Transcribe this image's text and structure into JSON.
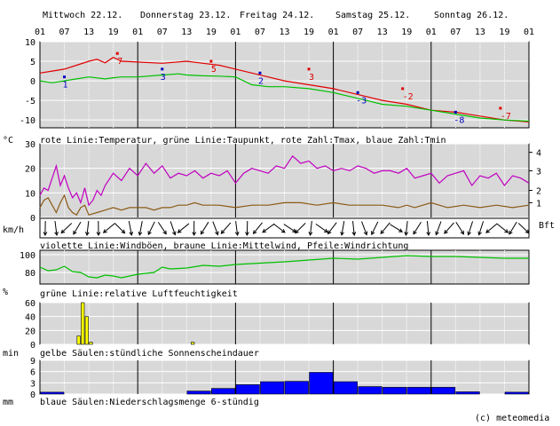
{
  "header": {
    "days": [
      "Mittwoch 22.12.",
      "Donnerstag 23.12.",
      "Freitag 24.12.",
      "Samstag 25.12.",
      "Sonntag 26.12."
    ],
    "hour_ticks": [
      "01",
      "07",
      "13",
      "19",
      "01",
      "07",
      "13",
      "19",
      "01",
      "07",
      "13",
      "19",
      "01",
      "07",
      "13",
      "19",
      "01",
      "07",
      "13",
      "19",
      "01"
    ]
  },
  "copyright": "(c) meteomedia",
  "colors": {
    "panel_bg": "#d8d8d8",
    "temperature": "#e00000",
    "dewpoint": "#00c000",
    "tmin": "#0000c0",
    "gust": "#c000c0",
    "mean_wind": "#8b5a16",
    "humidity": "#00c000",
    "sun_bar": "#ffff00",
    "precip_bar": "#0000ff"
  },
  "chart_data": [
    {
      "type": "line",
      "panel": "temperature",
      "unit_label": "°C",
      "caption": "rote Linie:Temperatur, grüne Linie:Taupunkt, rote Zahl:Tmax, blaue Zahl:Tmin",
      "y_ticks": [
        10,
        5,
        0,
        -5,
        -10
      ],
      "ylim": [
        -12,
        10
      ],
      "x_unit": "hours since Mi 22.12. 01:00",
      "xlim": [
        0,
        120
      ],
      "series": [
        {
          "name": "Temperatur",
          "color": "temperature",
          "x": [
            0,
            3,
            6,
            9,
            12,
            14,
            16,
            18,
            20,
            24,
            30,
            36,
            40,
            44,
            48,
            52,
            56,
            60,
            66,
            72,
            76,
            80,
            84,
            90,
            96,
            102,
            108,
            114,
            120
          ],
          "y": [
            2,
            2.5,
            3,
            4,
            5,
            5.5,
            4.6,
            6,
            5,
            4.8,
            4.5,
            5,
            4.5,
            4,
            3,
            2,
            1,
            0,
            -1,
            -2,
            -3,
            -4,
            -5,
            -6,
            -7.5,
            -8,
            -9,
            -10,
            -10.5
          ]
        },
        {
          "name": "Taupunkt",
          "color": "dewpoint",
          "x": [
            0,
            3,
            6,
            9,
            12,
            16,
            18,
            20,
            24,
            30,
            34,
            36,
            40,
            44,
            48,
            52,
            56,
            60,
            66,
            72,
            76,
            80,
            84,
            90,
            96,
            102,
            108,
            114,
            120
          ],
          "y": [
            0,
            -0.5,
            0,
            0.5,
            1,
            0.5,
            0.8,
            1,
            1,
            1.5,
            1.8,
            1.5,
            1.3,
            1.2,
            1,
            -1,
            -1.5,
            -1.5,
            -2,
            -3,
            -4,
            -5,
            -6,
            -6.5,
            -7.5,
            -8.5,
            -9.5,
            -10,
            -10.3
          ]
        }
      ],
      "tmax": [
        {
          "x": 19,
          "label": "7",
          "y": 7
        },
        {
          "x": 42,
          "label": "5",
          "y": 5
        },
        {
          "x": 66,
          "label": "3",
          "y": 3
        },
        {
          "x": 89,
          "label": "-2",
          "y": -2
        },
        {
          "x": 113,
          "label": "-7",
          "y": -7
        }
      ],
      "tmin": [
        {
          "x": 6,
          "label": "1",
          "y": 1
        },
        {
          "x": 30,
          "label": "3",
          "y": 3
        },
        {
          "x": 54,
          "label": "2",
          "y": 2
        },
        {
          "x": 78,
          "label": "-3",
          "y": -3
        },
        {
          "x": 102,
          "label": "-8",
          "y": -8
        }
      ]
    },
    {
      "type": "line",
      "panel": "wind",
      "unit_label": "km/h",
      "right_unit_label": "Bft",
      "caption": "violette Linie:Windböen, braune Linie:Mittelwind, Pfeile:Windrichtung",
      "y_ticks": [
        30,
        20,
        10,
        0
      ],
      "ylim": [
        0,
        30
      ],
      "right_ticks": [
        "4",
        "3",
        "2",
        "1"
      ],
      "right_tick_values": [
        26.5,
        19,
        11,
        6
      ],
      "x_unit": "hours since Mi 22.12. 01:00",
      "xlim": [
        0,
        120
      ],
      "series": [
        {
          "name": "Windböen",
          "color": "gust",
          "x": [
            0,
            1,
            2,
            3,
            4,
            5,
            6,
            7,
            8,
            9,
            10,
            11,
            12,
            13,
            14,
            15,
            16,
            18,
            20,
            22,
            24,
            26,
            28,
            30,
            32,
            34,
            36,
            38,
            40,
            42,
            44,
            46,
            48,
            50,
            52,
            54,
            56,
            58,
            60,
            62,
            64,
            66,
            68,
            70,
            72,
            74,
            76,
            78,
            80,
            82,
            84,
            86,
            88,
            90,
            92,
            94,
            96,
            98,
            100,
            102,
            104,
            106,
            108,
            110,
            112,
            114,
            116,
            118,
            120
          ],
          "y": [
            9,
            12,
            11,
            16,
            21,
            13,
            17,
            12,
            8,
            10,
            6,
            12,
            5,
            7,
            11,
            9,
            13,
            18,
            15,
            20,
            17,
            22,
            18,
            21,
            16,
            18,
            17,
            19,
            16,
            18,
            17,
            19,
            14,
            18,
            20,
            19,
            18,
            21,
            20,
            25,
            22,
            23,
            20,
            21,
            19,
            20,
            19,
            21,
            20,
            18,
            19,
            19,
            18,
            20,
            16,
            17,
            18,
            14,
            17,
            18,
            19,
            13,
            17,
            16,
            18,
            13,
            17,
            16,
            14
          ]
        },
        {
          "name": "Mittelwind",
          "color": "mean_wind",
          "x": [
            0,
            1,
            2,
            3,
            4,
            5,
            6,
            7,
            8,
            9,
            10,
            11,
            12,
            14,
            16,
            18,
            20,
            22,
            24,
            26,
            28,
            30,
            32,
            34,
            36,
            38,
            40,
            44,
            48,
            52,
            56,
            60,
            64,
            68,
            72,
            76,
            80,
            84,
            88,
            90,
            92,
            96,
            100,
            104,
            108,
            112,
            116,
            120
          ],
          "y": [
            4,
            7,
            8,
            5,
            2,
            6,
            9,
            4,
            2,
            1,
            4,
            5,
            1,
            2,
            3,
            4,
            3,
            4,
            4,
            4,
            3,
            4,
            4,
            5,
            5,
            6,
            5,
            5,
            4,
            5,
            5,
            6,
            6,
            5,
            6,
            5,
            5,
            5,
            4,
            5,
            4,
            6,
            4,
            5,
            4,
            5,
            4,
            5
          ]
        }
      ],
      "wind_direction": "arrows along top edge"
    },
    {
      "type": "line",
      "panel": "humidity",
      "unit_label": "%",
      "caption": "grüne Linie:relative Luftfeuchtigkeit",
      "y_ticks": [
        100,
        80
      ],
      "ylim": [
        67,
        105
      ],
      "x_unit": "hours since Mi 22.12. 01:00",
      "xlim": [
        0,
        120
      ],
      "series": [
        {
          "name": "relative Luftfeuchtigkeit",
          "color": "humidity",
          "x": [
            0,
            2,
            4,
            6,
            8,
            10,
            12,
            14,
            16,
            18,
            20,
            24,
            28,
            30,
            32,
            36,
            40,
            44,
            48,
            52,
            56,
            60,
            66,
            72,
            78,
            84,
            90,
            96,
            102,
            108,
            114,
            120
          ],
          "y": [
            86,
            82,
            83,
            87,
            81,
            80,
            75,
            74,
            77,
            76,
            74,
            78,
            80,
            86,
            84,
            85,
            88,
            87,
            89,
            90,
            91,
            92,
            94,
            96,
            95,
            97,
            99,
            98,
            98,
            97,
            96,
            96
          ]
        }
      ]
    },
    {
      "type": "bar",
      "panel": "sunshine",
      "unit_label": "min",
      "caption": "gelbe Säulen:stündliche Sonnenscheindauer",
      "y_ticks": [
        60,
        40,
        20,
        0
      ],
      "ylim": [
        0,
        60
      ],
      "x_unit": "hours since Mi 22.12. 01:00",
      "xlim": [
        0,
        120
      ],
      "bar_width_hours": 1,
      "x": [
        9,
        10,
        11,
        12,
        37
      ],
      "values": [
        12,
        60,
        40,
        3,
        3
      ]
    },
    {
      "type": "bar",
      "panel": "precipitation",
      "unit_label": "mm",
      "caption": "blaue Säulen:Niederschlagsmenge 6-stündig",
      "y_ticks": [
        9,
        6,
        3,
        0
      ],
      "ylim": [
        0,
        9
      ],
      "x_unit": "hours since Mi 22.12. 01:00",
      "xlim": [
        0,
        120
      ],
      "bar_width_hours": 6,
      "x": [
        0,
        6,
        12,
        18,
        24,
        30,
        36,
        42,
        48,
        54,
        60,
        66,
        72,
        78,
        84,
        90,
        96,
        102,
        108,
        114
      ],
      "values": [
        0.5,
        0,
        0,
        0,
        0,
        0,
        0.8,
        1.5,
        2.5,
        3.3,
        3.4,
        5.8,
        3.3,
        2,
        1.8,
        1.8,
        1.8,
        0.6,
        0,
        0.5
      ]
    }
  ]
}
